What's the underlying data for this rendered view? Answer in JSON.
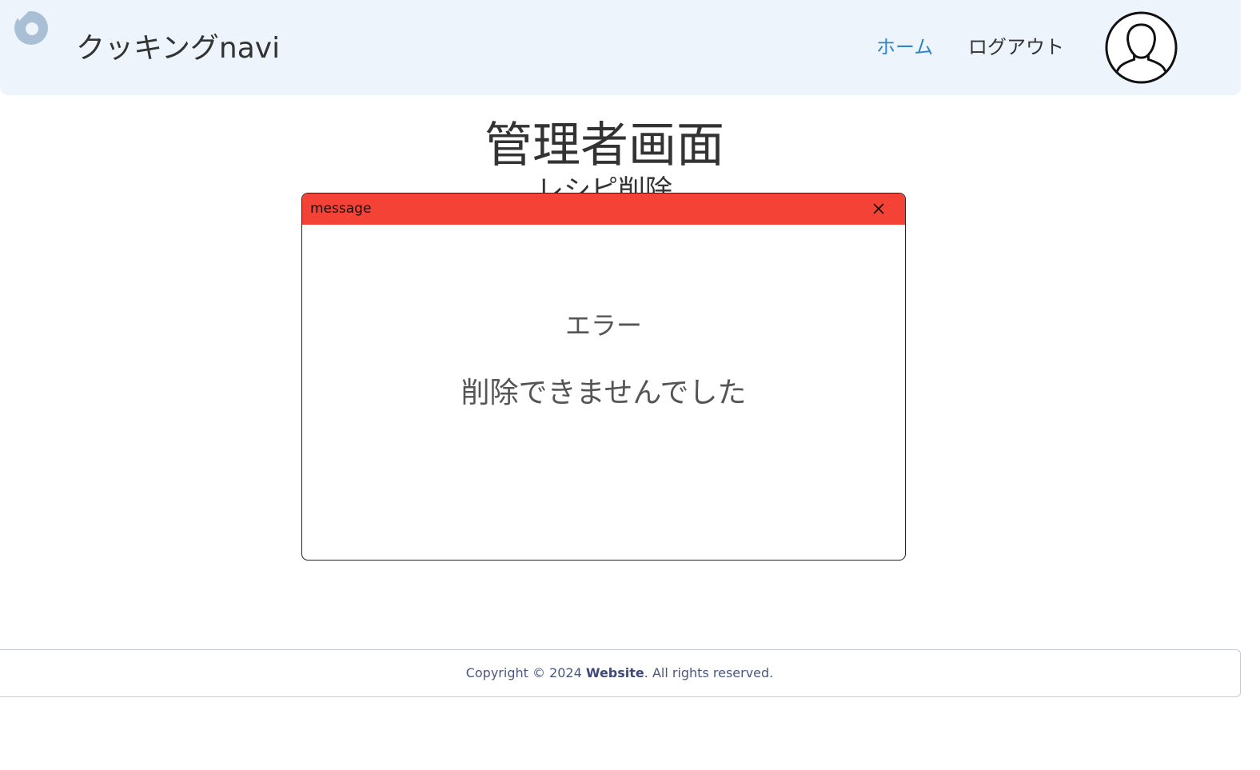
{
  "header": {
    "brand": "クッキングnavi",
    "nav": {
      "home": "ホーム",
      "logout": "ログアウト"
    }
  },
  "main": {
    "title": "管理者画面",
    "subtitle": "レシピ削除"
  },
  "modal": {
    "title": "message",
    "heading": "エラー",
    "message": "削除できませんでした"
  },
  "footer": {
    "prefix": "Copyright © 2024 ",
    "site": "Website",
    "suffix": ". All rights reserved."
  },
  "colors": {
    "header_bg": "#eef4fb",
    "nav_active": "#2f86c6",
    "modal_header": "#f44336"
  },
  "icons": {
    "logo": "logo-icon",
    "avatar": "user-avatar-icon",
    "close": "close-icon"
  }
}
